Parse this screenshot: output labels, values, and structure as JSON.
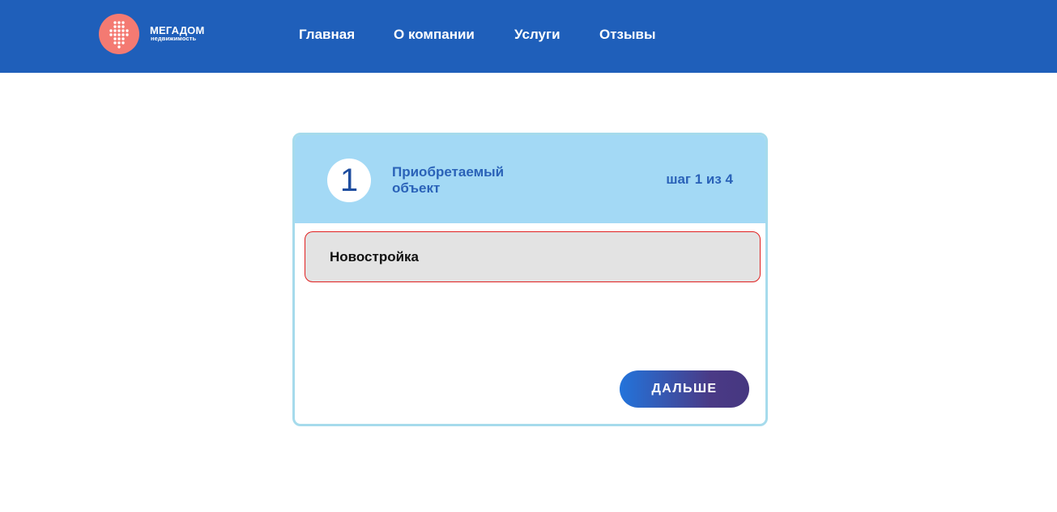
{
  "header": {
    "logo": {
      "title": "МЕГАДОМ",
      "subtitle": "недвижимость",
      "icon": "dots-arrow-down-icon"
    },
    "nav": [
      {
        "label": "Главная"
      },
      {
        "label": "О компании"
      },
      {
        "label": "Услуги"
      },
      {
        "label": "Отзывы"
      }
    ]
  },
  "quiz": {
    "step_number": "1",
    "title": "Приобретаемый объект",
    "counter": "шаг 1 из 4",
    "options": [
      {
        "label": "Новостройка",
        "selected": true
      }
    ],
    "next_label": "ДАЛЬШЕ"
  },
  "colors": {
    "header_bg": "#1f5fba",
    "logo_circle": "#f47a72",
    "quiz_header_bg": "#a3d9f5",
    "quiz_border": "#a6dbec",
    "accent_text": "#2a62b8",
    "option_border": "#e02020",
    "button_gradient_start": "#2374db",
    "button_gradient_end": "#463780"
  }
}
